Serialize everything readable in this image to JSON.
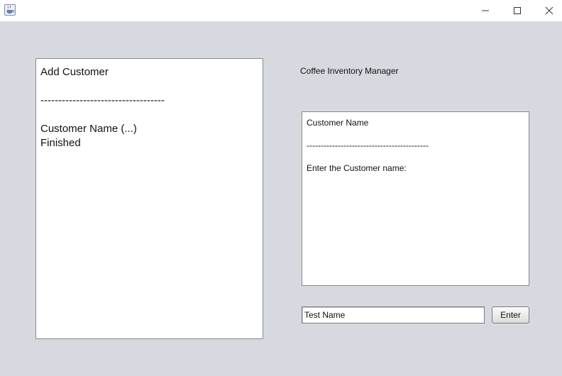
{
  "window": {
    "icon": "java-cup-icon",
    "controls": {
      "minimize": "minimize-icon",
      "maximize": "maximize-icon",
      "close": "close-icon"
    }
  },
  "left_panel": {
    "lines": [
      "Add Customer",
      "",
      "-----------------------------------",
      "",
      "Customer Name (...)",
      "Finished"
    ]
  },
  "header": {
    "title": "Coffee Inventory Manager"
  },
  "right_panel": {
    "lines": [
      "Customer Name",
      "",
      "-------------------------------------------",
      "",
      "Enter the Customer name:"
    ]
  },
  "input": {
    "value": "Test Name"
  },
  "enter_button": {
    "label": "Enter"
  }
}
